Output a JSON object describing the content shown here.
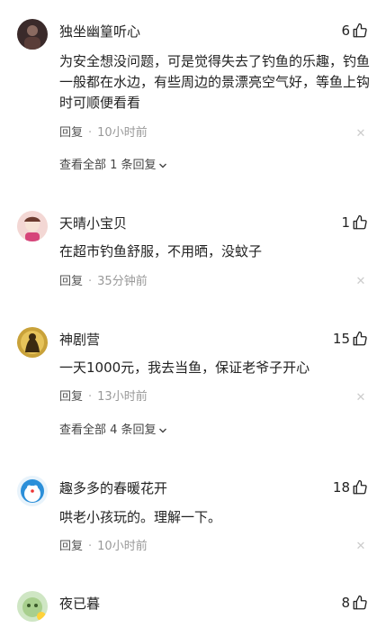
{
  "comments": [
    {
      "username": "独坐幽篁听心",
      "likes": "6",
      "text": "为安全想没问题，可是觉得失去了钓鱼的乐趣，钓鱼一般都在水边，有些周边的景漂亮空气好，等鱼上钩时可顺便看看",
      "reply_label": "回复",
      "time": "10小时前",
      "more_replies": "查看全部 1 条回复"
    },
    {
      "username": "天晴小宝贝",
      "likes": "1",
      "text": "在超市钓鱼舒服，不用晒，没蚊子",
      "reply_label": "回复",
      "time": "35分钟前"
    },
    {
      "username": "神剧营",
      "likes": "15",
      "text": "一天1000元，我去当鱼，保证老爷子开心",
      "reply_label": "回复",
      "time": "13小时前",
      "more_replies": "查看全部 4 条回复"
    },
    {
      "username": "趣多多的春暖花开",
      "likes": "18",
      "text": "哄老小孩玩的。理解一下。",
      "reply_label": "回复",
      "time": "10小时前"
    },
    {
      "username": "夜已暮",
      "likes": "8"
    }
  ],
  "separator": "·",
  "icons": {
    "like": "thumbs-up-icon",
    "close": "close-icon",
    "expand": "chevron-down-icon"
  },
  "colors": {
    "text": "#222222",
    "meta": "#999999"
  }
}
